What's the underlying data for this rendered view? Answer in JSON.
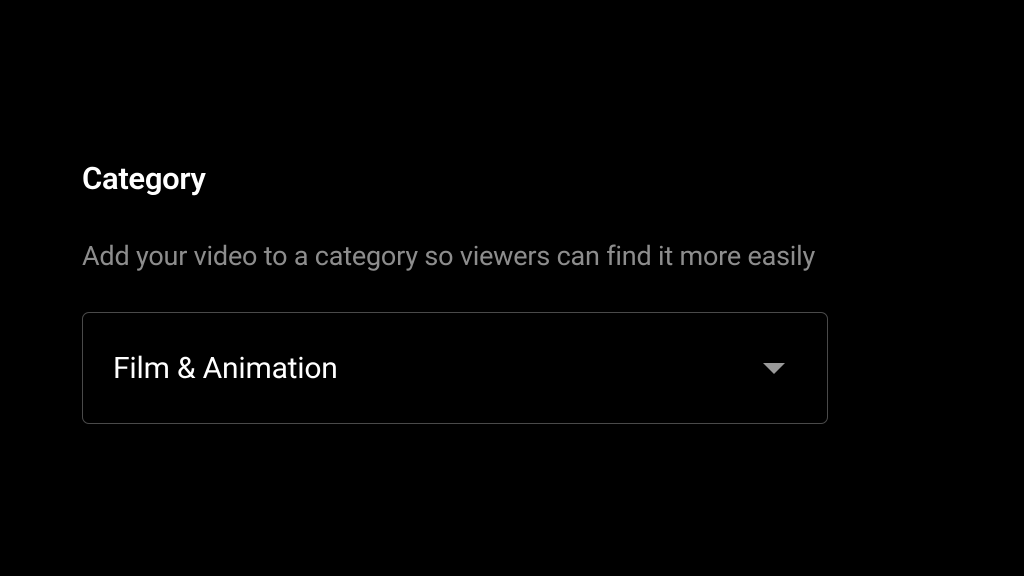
{
  "section": {
    "heading": "Category",
    "description": "Add your video to a category so viewers can find it more easily",
    "select": {
      "selected_value": "Film & Animation"
    }
  }
}
